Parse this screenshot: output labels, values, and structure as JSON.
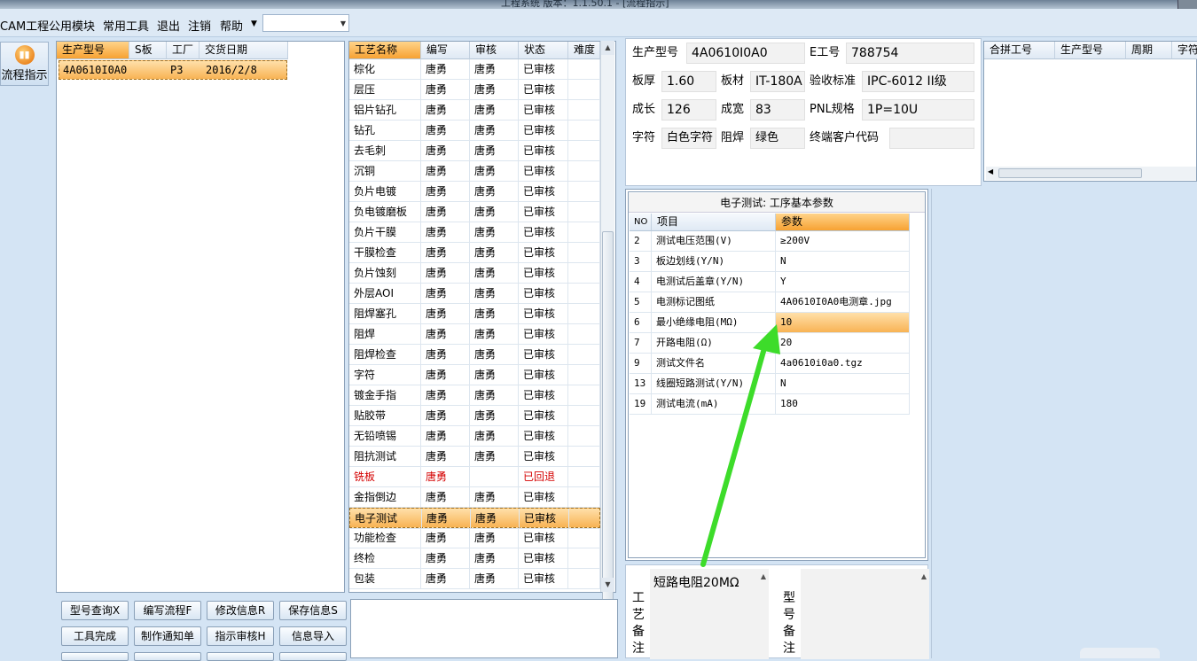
{
  "window": {
    "title": "工程系统 版本：1.1.50.1 - [流程指示]"
  },
  "menu": {
    "items": [
      "CAM工程",
      "公用模块",
      "常用工具",
      "退出",
      "注销",
      "帮助"
    ],
    "combo_value": ""
  },
  "sidebar": {
    "flow_button": "流程指示"
  },
  "orders": {
    "columns": [
      "生产型号",
      "S板",
      "工厂",
      "交货日期"
    ],
    "rows": [
      {
        "model": "4A0610I0A0",
        "s": "",
        "factory": "P3",
        "date": "2016/2/8"
      }
    ]
  },
  "processes": {
    "columns": [
      "工艺名称",
      "编写",
      "审核",
      "状态",
      "难度"
    ],
    "rows": [
      {
        "name": "棕化",
        "writer": "唐勇",
        "reviewer": "唐勇",
        "status": "已审核"
      },
      {
        "name": "层压",
        "writer": "唐勇",
        "reviewer": "唐勇",
        "status": "已审核"
      },
      {
        "name": "铝片钻孔",
        "writer": "唐勇",
        "reviewer": "唐勇",
        "status": "已审核"
      },
      {
        "name": "钻孔",
        "writer": "唐勇",
        "reviewer": "唐勇",
        "status": "已审核"
      },
      {
        "name": "去毛刺",
        "writer": "唐勇",
        "reviewer": "唐勇",
        "status": "已审核"
      },
      {
        "name": "沉铜",
        "writer": "唐勇",
        "reviewer": "唐勇",
        "status": "已审核"
      },
      {
        "name": "负片电镀",
        "writer": "唐勇",
        "reviewer": "唐勇",
        "status": "已审核"
      },
      {
        "name": "负电镀磨板",
        "writer": "唐勇",
        "reviewer": "唐勇",
        "status": "已审核"
      },
      {
        "name": "负片干膜",
        "writer": "唐勇",
        "reviewer": "唐勇",
        "status": "已审核"
      },
      {
        "name": "干膜检查",
        "writer": "唐勇",
        "reviewer": "唐勇",
        "status": "已审核"
      },
      {
        "name": "负片蚀刻",
        "writer": "唐勇",
        "reviewer": "唐勇",
        "status": "已审核"
      },
      {
        "name": "外层AOI",
        "writer": "唐勇",
        "reviewer": "唐勇",
        "status": "已审核"
      },
      {
        "name": "阻焊塞孔",
        "writer": "唐勇",
        "reviewer": "唐勇",
        "status": "已审核"
      },
      {
        "name": "阻焊",
        "writer": "唐勇",
        "reviewer": "唐勇",
        "status": "已审核"
      },
      {
        "name": "阻焊检查",
        "writer": "唐勇",
        "reviewer": "唐勇",
        "status": "已审核"
      },
      {
        "name": "字符",
        "writer": "唐勇",
        "reviewer": "唐勇",
        "status": "已审核"
      },
      {
        "name": "镀金手指",
        "writer": "唐勇",
        "reviewer": "唐勇",
        "status": "已审核"
      },
      {
        "name": "贴胶带",
        "writer": "唐勇",
        "reviewer": "唐勇",
        "status": "已审核"
      },
      {
        "name": "无铅喷锡",
        "writer": "唐勇",
        "reviewer": "唐勇",
        "status": "已审核"
      },
      {
        "name": "阻抗测试",
        "writer": "唐勇",
        "reviewer": "唐勇",
        "status": "已审核"
      },
      {
        "name": "铣板",
        "writer": "唐勇",
        "reviewer": "",
        "status": "已回退"
      },
      {
        "name": "金指倒边",
        "writer": "唐勇",
        "reviewer": "唐勇",
        "status": "已审核"
      },
      {
        "name": "电子测试",
        "writer": "唐勇",
        "reviewer": "唐勇",
        "status": "已审核"
      },
      {
        "name": "功能检查",
        "writer": "唐勇",
        "reviewer": "唐勇",
        "status": "已审核"
      },
      {
        "name": "终检",
        "writer": "唐勇",
        "reviewer": "唐勇",
        "status": "已审核"
      },
      {
        "name": "包装",
        "writer": "唐勇",
        "reviewer": "唐勇",
        "status": "已审核"
      }
    ]
  },
  "buttons": {
    "row1": [
      "型号查询X",
      "编写流程F",
      "修改信息R",
      "保存信息S"
    ],
    "row2": [
      "工具完成",
      "制作通知单",
      "指示审核H",
      "信息导入"
    ]
  },
  "info": {
    "model_label": "生产型号",
    "model_value": "4A0610I0A0",
    "e_label": "E工号",
    "e_value": "788754",
    "thickness_label": "板厚",
    "thickness_value": "1.60",
    "material_label": "板材",
    "material_value": "IT-180A",
    "standard_label": "验收标准",
    "standard_value": "IPC-6012 II级",
    "length_label": "成长",
    "length_value": "126",
    "width_label": "成宽",
    "width_value": "83",
    "pnl_label": "PNL规格",
    "pnl_value": "1P=10U",
    "char_label": "字符",
    "char_value": "白色字符",
    "mask_label": "阻焊",
    "mask_value": "绿色",
    "customer_label": "终端客户代码",
    "customer_value": ""
  },
  "merge": {
    "columns": [
      "合拼工号",
      "生产型号",
      "周期",
      "字符"
    ]
  },
  "etest": {
    "title": "电子测试: 工序基本参数",
    "columns": [
      "NO",
      "项目",
      "参数"
    ],
    "rows": [
      {
        "no": "2",
        "item": "测试电压范围(V)",
        "param": "≥200V"
      },
      {
        "no": "3",
        "item": "板边划线(Y/N)",
        "param": "N"
      },
      {
        "no": "4",
        "item": "电测试后盖章(Y/N)",
        "param": "Y"
      },
      {
        "no": "5",
        "item": "电测标记图纸",
        "param": "4A0610I0A0电测章.jpg"
      },
      {
        "no": "6",
        "item": "最小绝缘电阻(MΩ)",
        "param": "10"
      },
      {
        "no": "7",
        "item": "开路电阻(Ω)",
        "param": "20"
      },
      {
        "no": "9",
        "item": "测试文件名",
        "param": "4a0610i0a0.tgz"
      },
      {
        "no": "13",
        "item": "线圈短路测试(Y/N)",
        "param": "N"
      },
      {
        "no": "19",
        "item": "测试电流(mA)",
        "param": "180"
      }
    ]
  },
  "notes": {
    "process_label": "工艺备注",
    "process_note": "短路电阻20MΩ",
    "model_label": "型号备注",
    "model_note": ""
  },
  "colors": {
    "selection": "#f8b354",
    "header": "#dfe9f4",
    "arrow": "#3ddc2a",
    "rejected": "#d40000"
  }
}
